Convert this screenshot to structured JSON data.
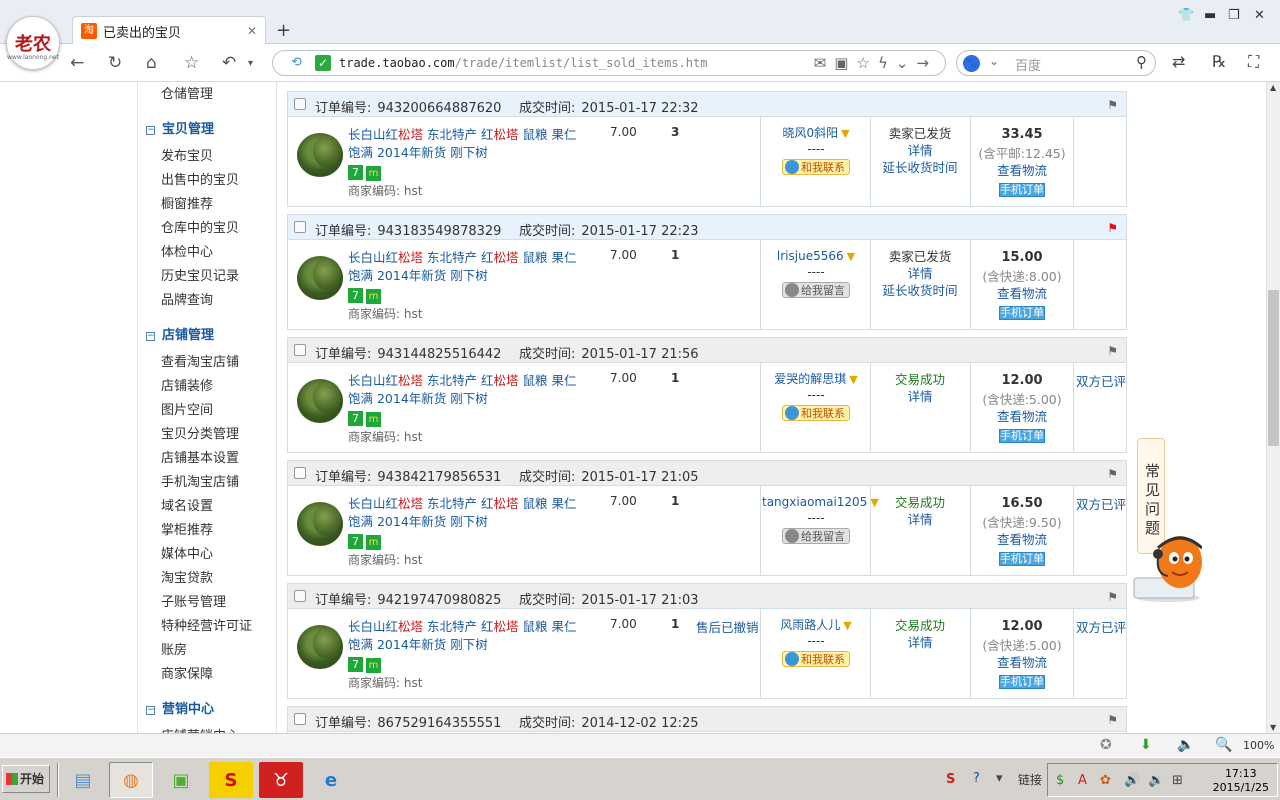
{
  "browser": {
    "logo_text": "老农",
    "logo_sub": "www.laonong.net",
    "tab_favicon": "淘",
    "tab_title": "已卖出的宝贝",
    "url_host": "trade.taobao.com",
    "url_path": "/trade/itemlist/list_sold_items.htm",
    "search_placeholder": "百度"
  },
  "sidebar": {
    "items_top": [
      "仓储管理"
    ],
    "sections": [
      {
        "title": "宝贝管理",
        "items": [
          "发布宝贝",
          "出售中的宝贝",
          "橱窗推荐",
          "仓库中的宝贝",
          "体检中心",
          "历史宝贝记录",
          "品牌查询"
        ]
      },
      {
        "title": "店铺管理",
        "items": [
          "查看淘宝店铺",
          "店铺装修",
          "图片空间",
          "宝贝分类管理",
          "店铺基本设置",
          "手机淘宝店铺",
          "域名设置",
          "掌柜推荐",
          "媒体中心",
          "淘宝贷款",
          "子账号管理",
          "特种经营许可证",
          "账房",
          "商家保障"
        ]
      },
      {
        "title": "营销中心",
        "items": [
          "店铺营销中心"
        ]
      }
    ]
  },
  "labels": {
    "order_no": "订单编号:",
    "deal_time": "成交时间:",
    "title_a": "长白山红",
    "title_b": "松塔",
    "title_c": " 东北特产 红",
    "title_d": "松塔",
    "title_e": " 鼠粮 果仁饱满 2014年新货 刚下树",
    "tag7": "7",
    "tagm": "m",
    "code": "商家编码: hst",
    "dash": "----",
    "contact_me": "和我联系",
    "leave_msg": "给我留言",
    "detail": "详情",
    "extend": "延长收货时间",
    "logistics": "查看物流",
    "mobile_order": "手机订单"
  },
  "orders": [
    {
      "no": "943200664887620",
      "time": "2015-01-17 22:32",
      "price": "7.00",
      "qty": "3",
      "after_sale": "",
      "buyer": "晓风0斜阳",
      "contact": "和我联系",
      "status": "卖家已发货",
      "total": "33.45",
      "shipping": "(含平邮:12.45)",
      "eval": "",
      "flag": "gray"
    },
    {
      "no": "943183549878329",
      "time": "2015-01-17 22:23",
      "price": "7.00",
      "qty": "1",
      "after_sale": "",
      "buyer": "lrisjue5566",
      "contact": "给我留言",
      "status": "卖家已发货",
      "total": "15.00",
      "shipping": "(含快递:8.00)",
      "eval": "",
      "flag": "red"
    },
    {
      "no": "943144825516442",
      "time": "2015-01-17 21:56",
      "price": "7.00",
      "qty": "1",
      "after_sale": "",
      "buyer": "爱哭的解思琪",
      "contact": "和我联系",
      "status": "交易成功",
      "total": "12.00",
      "shipping": "(含快递:5.00)",
      "eval": "双方已评",
      "flag": "gray"
    },
    {
      "no": "943842179856531",
      "time": "2015-01-17 21:05",
      "price": "7.00",
      "qty": "1",
      "after_sale": "",
      "buyer": "tangxiaomai1205",
      "contact": "给我留言",
      "status": "交易成功",
      "total": "16.50",
      "shipping": "(含快递:9.50)",
      "eval": "双方已评",
      "flag": "gray"
    },
    {
      "no": "942197470980825",
      "time": "2015-01-17 21:03",
      "price": "7.00",
      "qty": "1",
      "after_sale": "售后已撤销",
      "buyer": "风雨路人儿",
      "contact": "和我联系",
      "status": "交易成功",
      "total": "12.00",
      "shipping": "(含快递:5.00)",
      "eval": "双方已评",
      "flag": "gray"
    },
    {
      "no": "867529164355551",
      "time": "2014-12-02 12:25",
      "flag": "gray"
    }
  ],
  "help": {
    "text": "常见问题"
  },
  "statusbar": {
    "zoom": "100%"
  },
  "taskbar": {
    "start": "开始",
    "tray_label": "链接",
    "time": "17:13",
    "date": "2015/1/25"
  }
}
